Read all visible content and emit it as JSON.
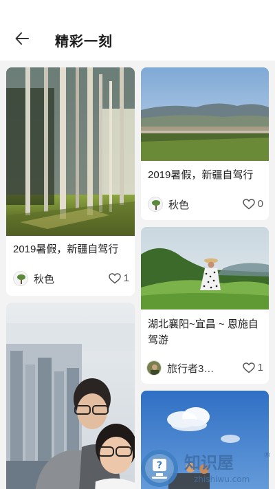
{
  "header": {
    "title": "精彩一刻"
  },
  "cards": [
    {
      "caption": "2019暑假，新疆自驾行",
      "author": "秋色",
      "likes": "1"
    },
    {
      "caption": "2019暑假，新疆自驾行",
      "author": "秋色",
      "likes": "0"
    },
    {
      "caption": "湖北襄阳~宜昌 ~ 恩施自驾游",
      "author": "旅行者3…",
      "likes": "1"
    }
  ],
  "watermark": {
    "brand": "知识屋",
    "registered": "®",
    "domain": "zhishiwu.com"
  },
  "icons": {
    "back": "arrow-left-icon",
    "like": "heart-outline-icon"
  },
  "colors": {
    "background": "#f3f3f3",
    "card": "#ffffff",
    "text": "#1f1f1f",
    "watermark": "#4a7fb5"
  }
}
